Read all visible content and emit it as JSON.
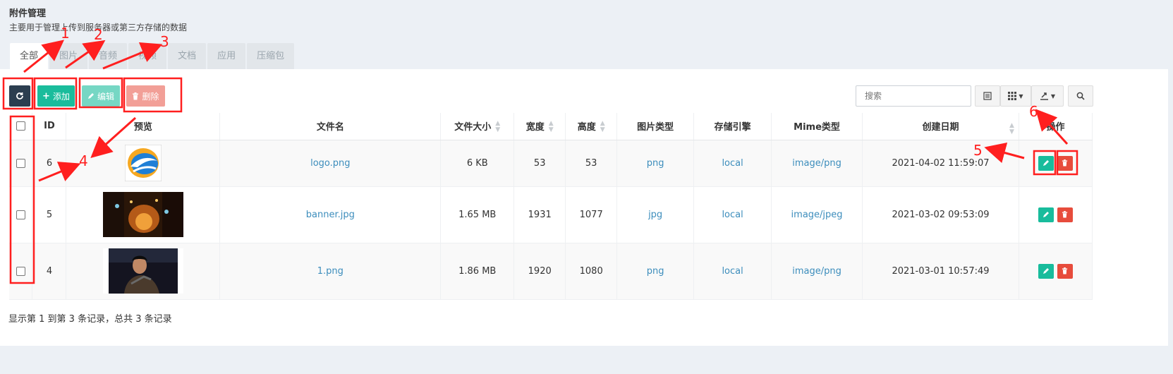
{
  "header": {
    "title": "附件管理",
    "subtitle": "主要用于管理上传到服务器或第三方存储的数据"
  },
  "tabs": [
    "全部",
    "图片",
    "音频",
    "视频",
    "文档",
    "应用",
    "压缩包"
  ],
  "toolbar": {
    "add_label": "添加",
    "edit_label": "编辑",
    "delete_label": "删除",
    "search_placeholder": "搜索"
  },
  "table": {
    "columns": [
      "ID",
      "预览",
      "文件名",
      "文件大小",
      "宽度",
      "高度",
      "图片类型",
      "存储引擎",
      "Mime类型",
      "创建日期",
      "操作"
    ],
    "rows": [
      {
        "id": "6",
        "filename": "logo.png",
        "size": "6 KB",
        "width": "53",
        "height": "53",
        "image_type": "png",
        "storage": "local",
        "mime": "image/png",
        "created": "2021-04-02 11:59:07"
      },
      {
        "id": "5",
        "filename": "banner.jpg",
        "size": "1.65 MB",
        "width": "1931",
        "height": "1077",
        "image_type": "jpg",
        "storage": "local",
        "mime": "image/jpeg",
        "created": "2021-03-02 09:53:09"
      },
      {
        "id": "4",
        "filename": "1.png",
        "size": "1.86 MB",
        "width": "1920",
        "height": "1080",
        "image_type": "png",
        "storage": "local",
        "mime": "image/png",
        "created": "2021-03-01 10:57:49"
      }
    ]
  },
  "footer": {
    "summary": "显示第 1 到第 3 条记录，总共 3 条记录"
  },
  "annotations": {
    "labels": [
      "1",
      "2",
      "3",
      "4",
      "5",
      "6"
    ],
    "color": "#ff1f1f"
  },
  "colors": {
    "primary_dark": "#2c3e50",
    "success": "#18bc9c",
    "danger": "#e74c3c",
    "link": "#3c8dbc"
  }
}
